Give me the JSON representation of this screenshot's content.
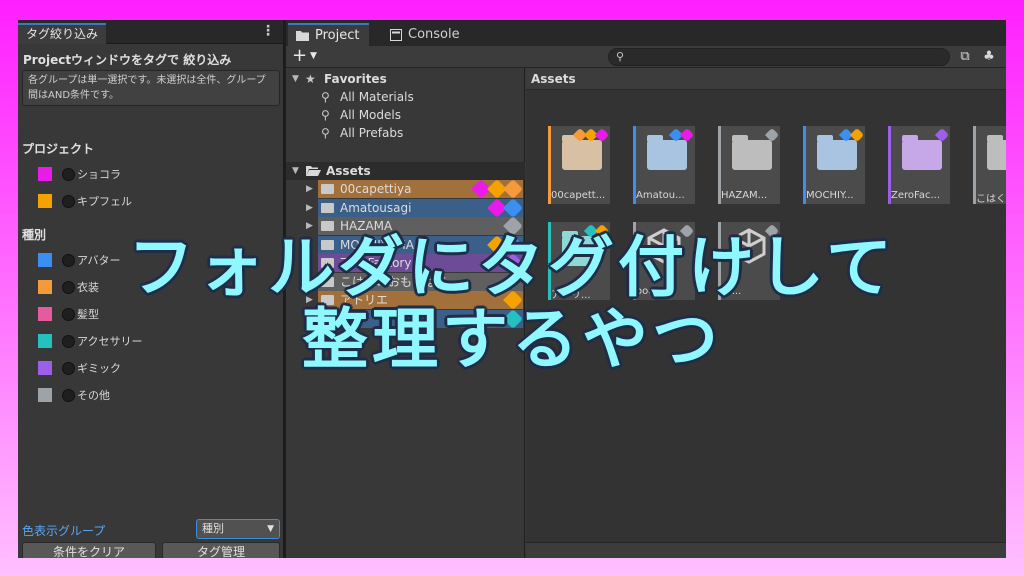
{
  "left_panel": {
    "tab_label": "タグ絞り込み",
    "menu_glyph": "⋮",
    "title": "Projectウィンドウをタグで 絞り込み",
    "help_line1": "各グループは単一選択です。未選択は全件、グループ",
    "help_line2": "間はAND条件です。",
    "groups": [
      {
        "heading": "プロジェクト",
        "items": [
          {
            "label": "ショコラ",
            "color": "#e81be8"
          },
          {
            "label": "キプフェル",
            "color": "#f5a100"
          }
        ]
      },
      {
        "heading": "種別",
        "items": [
          {
            "label": "アバター",
            "color": "#3b8ff0"
          },
          {
            "label": "衣装",
            "color": "#f59a3a"
          },
          {
            "label": "髪型",
            "color": "#e45ba0"
          },
          {
            "label": "アクセサリー",
            "color": "#25c0c0"
          },
          {
            "label": "ギミック",
            "color": "#9d5fe8"
          },
          {
            "label": "その他",
            "color": "#9ea3a8"
          }
        ]
      }
    ],
    "color_group_label": "色表示グループ",
    "color_group_value": "種別",
    "clear_button": "条件をクリア",
    "manage_button": "タグ管理"
  },
  "project_window": {
    "tabs": [
      {
        "label": "Project",
        "icon": "folder-icon"
      },
      {
        "label": "Console",
        "icon": "console-icon"
      }
    ],
    "search_placeholder": "",
    "tree": {
      "favorites_label": "Favorites",
      "favorites": [
        "All Materials",
        "All Models",
        "All Prefabs"
      ],
      "assets_label": "Assets",
      "items": [
        {
          "label": "00capettiya",
          "color": "#c9843a",
          "tags": [
            "#e81be8",
            "#f5a100",
            "#f59a3a"
          ]
        },
        {
          "label": "Amatousagi",
          "color": "#3b6fa8",
          "tags": [
            "#e81be8",
            "#3b8ff0"
          ]
        },
        {
          "label": "HAZAMA",
          "color": "#6d6d6d",
          "tags": [
            "#9ea3a8"
          ]
        },
        {
          "label": "MOCHIYAMA",
          "color": "#3b6fa8",
          "tags": [
            "#f5a100",
            "#3b8ff0"
          ]
        },
        {
          "label": "ZeroFactory",
          "color": "#7f52b9",
          "tags": [
            "#9d5fe8"
          ]
        },
        {
          "label": "こはくのおもちばこ",
          "color": "#6d6d6d",
          "tags": []
        },
        {
          "label": "アトリエ",
          "color": "#c9843a",
          "tags": [
            "#f5a100"
          ]
        },
        {
          "label": "",
          "color": "#3b6fa8",
          "tags": [
            "#25c0c0"
          ]
        }
      ]
    },
    "grid": {
      "breadcrumb": "Assets",
      "tiles": [
        {
          "name": "00capett...",
          "kind": "folder",
          "folder_color": "#d7c0a4",
          "stripe": "#f59a3a",
          "tags": [
            "#f59a3a",
            "#f5a100",
            "#e81be8"
          ]
        },
        {
          "name": "Amatou...",
          "kind": "folder",
          "folder_color": "#a9c4e0",
          "stripe": "#3b8ff0",
          "tags": [
            "#3b8ff0",
            "#e81be8"
          ]
        },
        {
          "name": "HAZAM...",
          "kind": "folder",
          "folder_color": "#bdbdbd",
          "stripe": "#9ea3a8",
          "tags": [
            "#9ea3a8"
          ]
        },
        {
          "name": "MOCHIY...",
          "kind": "folder",
          "folder_color": "#a9c4e0",
          "stripe": "#3b8ff0",
          "tags": [
            "#3b8ff0",
            "#f5a100"
          ]
        },
        {
          "name": "ZeroFac...",
          "kind": "folder",
          "folder_color": "#c6a7e8",
          "stripe": "#9d5fe8",
          "tags": [
            "#9d5fe8"
          ]
        },
        {
          "name": "こはくの",
          "kind": "folder",
          "folder_color": "#bdbdbd",
          "stripe": "#9ea3a8",
          "tags": []
        },
        {
          "name": "アトリ...",
          "kind": "folder",
          "folder_color": "#8fd8d8",
          "stripe": "#25c0c0",
          "tags": [
            "#25c0c0",
            "#f5a100"
          ]
        },
        {
          "name": "ooc...",
          "kind": "unity",
          "folder_color": "#cfcfcf",
          "stripe": "#9ea3a8",
          "tags": [
            "#9ea3a8"
          ]
        },
        {
          "name": "sc...",
          "kind": "unity",
          "folder_color": "#cfcfcf",
          "stripe": "#9ea3a8",
          "tags": [
            "#9ea3a8"
          ]
        }
      ]
    }
  },
  "overlay": {
    "line1": "フォルダにタグ付けして",
    "line2": "整理するやつ",
    "color": "#8ff8ff"
  }
}
